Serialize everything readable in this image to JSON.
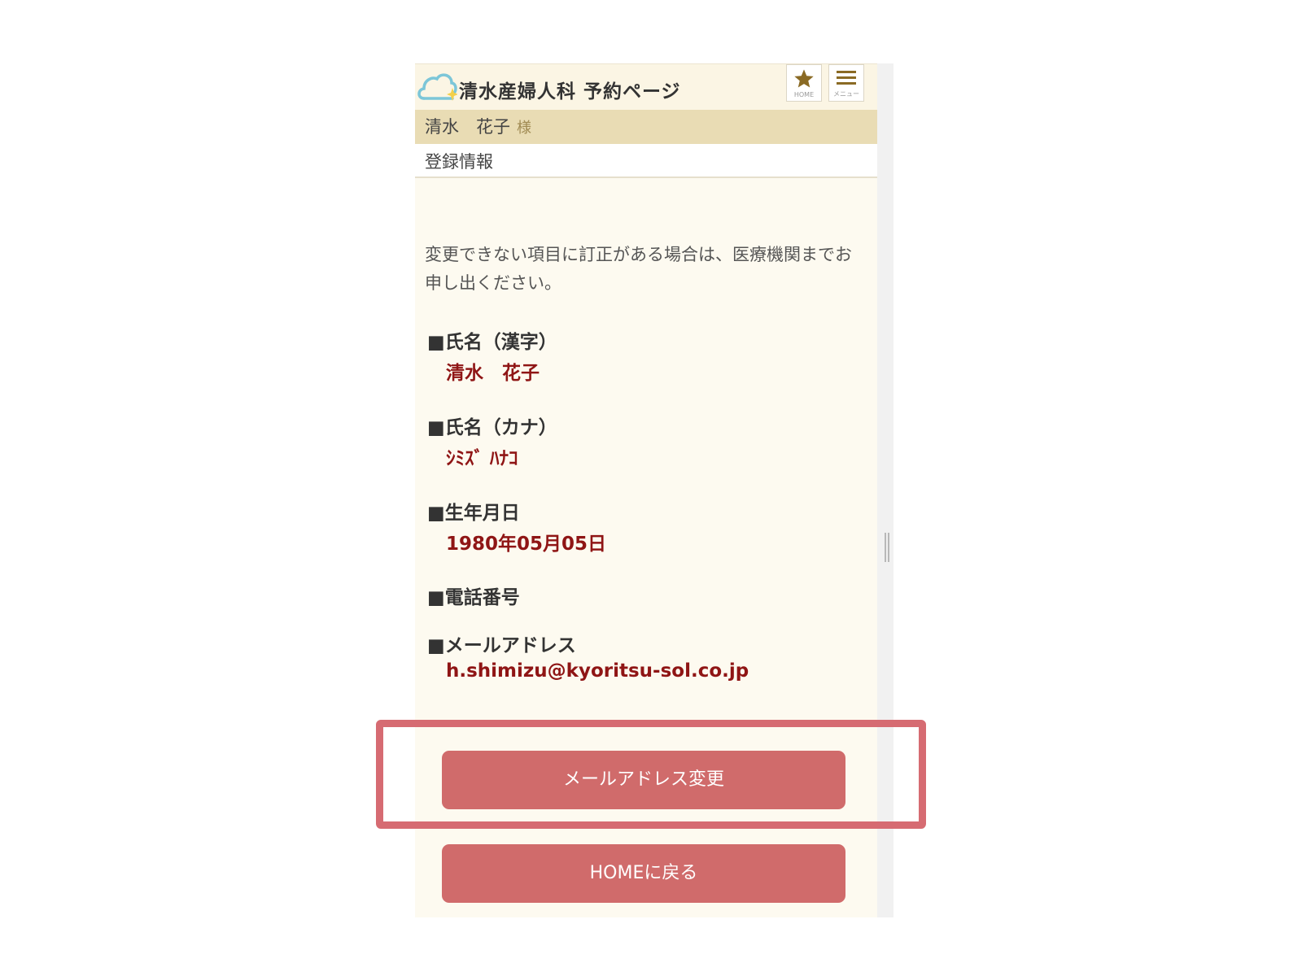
{
  "header": {
    "clinic_title": "清水産婦人科 予約ページ",
    "home_icon_label": "HOME",
    "menu_icon_label": "メニュー"
  },
  "user": {
    "name": "清水　花子",
    "honorific": "様"
  },
  "section": {
    "title": "登録情報"
  },
  "notice": "変更できない項目に訂正がある場合は、医療機関までお申し出ください。",
  "fields": [
    {
      "label": "■氏名（漢字）",
      "value": "清水　花子"
    },
    {
      "label": "■氏名（カナ）",
      "value": "ｼﾐｽﾞ ﾊﾅｺ"
    },
    {
      "label": "■生年月日",
      "value": "1980年05月05日"
    },
    {
      "label": "■電話番号",
      "value": ""
    },
    {
      "label": "■メールアドレス",
      "value": "h.shimizu@kyoritsu-sol.co.jp"
    }
  ],
  "buttons": {
    "change_email": "メールアドレス変更",
    "back_home": "HOMEに戻る"
  },
  "colors": {
    "accent_button": "#d06b6b",
    "value_text": "#8f1515",
    "user_bar": "#e9dcb4",
    "highlight_frame": "#d66b72"
  }
}
